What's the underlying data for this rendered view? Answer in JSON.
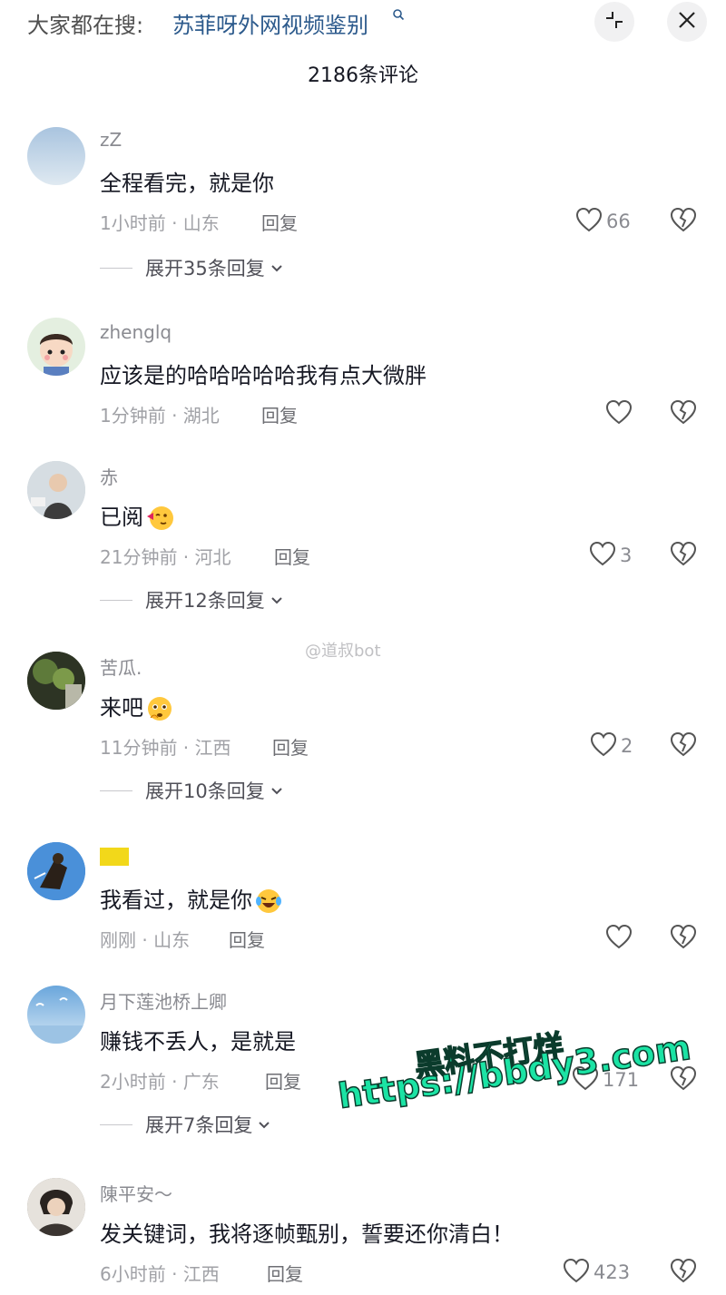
{
  "search": {
    "prefix": "大家都在搜:",
    "term": "苏菲呀外网视频鉴别",
    "icon": "search-icon"
  },
  "header": {
    "comment_count": "2186条评论",
    "minimize_icon": "minimize-icon",
    "close_icon": "close-icon"
  },
  "comments": [
    {
      "username": "zZ",
      "text": "全程看完，就是你",
      "meta": "1小时前 · 山东",
      "reply_label": "回复",
      "likes": "66",
      "expand": "展开35条回复",
      "avatar_color": "#b9cfe3"
    },
    {
      "username": "zhenglq",
      "text": "应该是的哈哈哈哈哈我有点大微胖",
      "meta": "1分钟前 · 湖北",
      "reply_label": "回复",
      "likes": "",
      "expand": "",
      "avatar_color": "#d9e9d6"
    },
    {
      "username": "赤",
      "text": "已阅",
      "meta": "21分钟前 · 河北",
      "reply_label": "回复",
      "likes": "3",
      "expand": "展开12条回复",
      "avatar_color": "#c7d2d8"
    },
    {
      "username": "苦瓜.",
      "text": "来吧",
      "meta": "11分钟前 · 江西",
      "reply_label": "回复",
      "likes": "2",
      "expand": "展开10条回复",
      "avatar_color": "#4d5a3a"
    },
    {
      "username": "",
      "text": "我看过，就是你",
      "meta": "刚刚 · 山东",
      "reply_label": "回复",
      "likes": "",
      "expand": "",
      "avatar_color": "#3b7fc4"
    },
    {
      "username": "月下莲池桥上卿",
      "text": "赚钱不丢人，是就是",
      "meta": "2小时前 · 广东",
      "reply_label": "回复",
      "likes": "171",
      "expand": "展开7条回复",
      "avatar_color": "#6fa5d6"
    },
    {
      "username": "陳平安～",
      "text": "发关键词，我将逐帧甄别，誓要还你清白！",
      "meta": "6小时前 · 江西",
      "reply_label": "回复",
      "likes": "423",
      "expand": "",
      "avatar_color": "#8a8580"
    }
  ],
  "watermark": "@道叔bot",
  "overlay_ad": {
    "line1": "黑料不打烊",
    "line2": "https://bbdy3.com"
  },
  "colors": {
    "link": "#2c5a8c",
    "muted": "#8a8b91",
    "ad_green": "#1be3a4"
  }
}
